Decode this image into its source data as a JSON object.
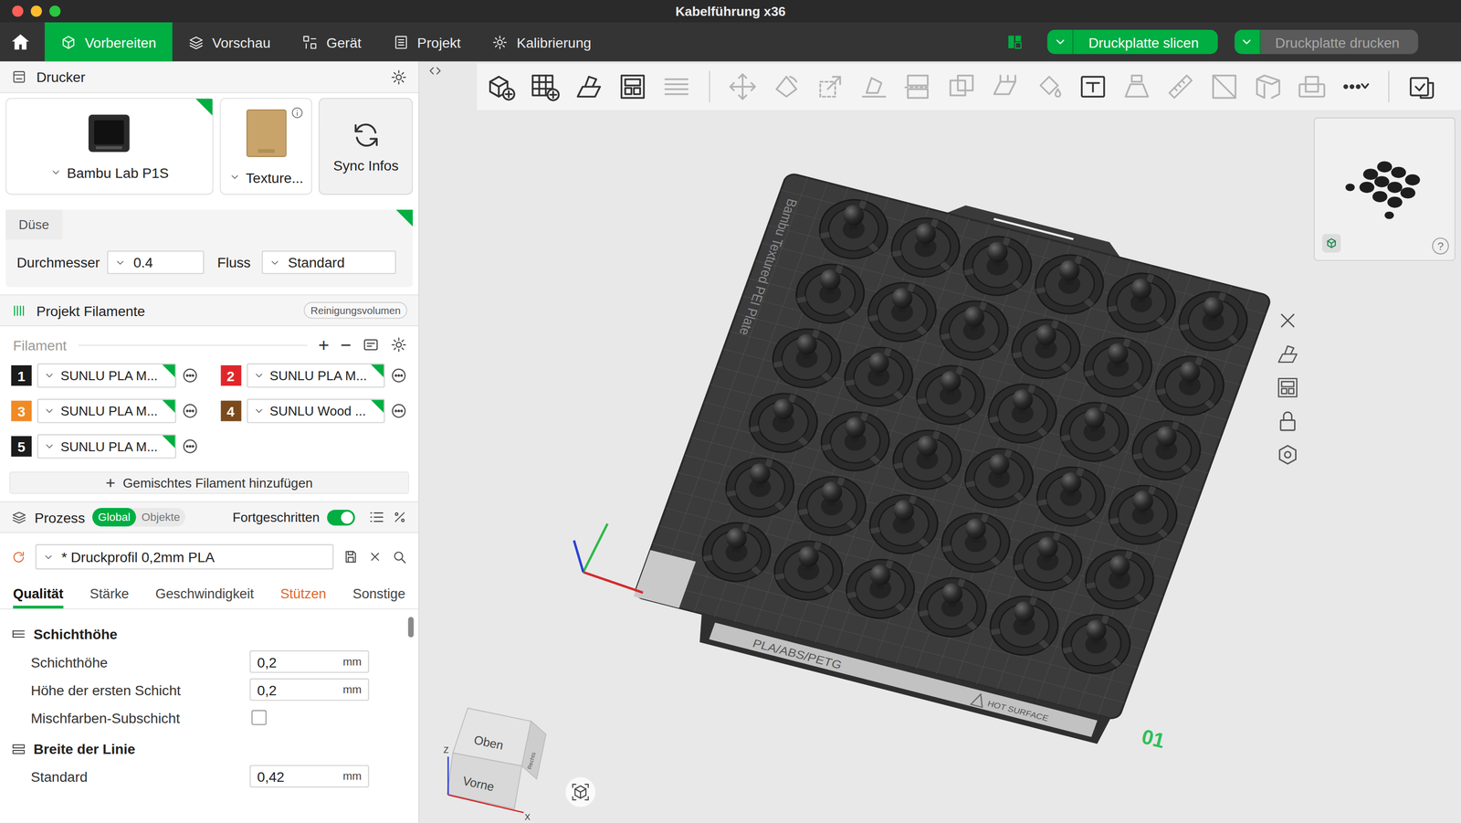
{
  "window": {
    "title": "Kabelführung x36"
  },
  "nav": [
    {
      "label": "Vorbereiten",
      "kind": "prepare",
      "selected": true
    },
    {
      "label": "Vorschau",
      "kind": "preview",
      "selected": false
    },
    {
      "label": "Gerät",
      "kind": "device",
      "selected": false
    },
    {
      "label": "Projekt",
      "kind": "project",
      "selected": false
    },
    {
      "label": "Kalibrierung",
      "kind": "calibrate",
      "selected": false
    }
  ],
  "actions": [
    {
      "label": "Druckplatte slicen",
      "disabled": false
    },
    {
      "label": "Druckplatte drucken",
      "disabled": true
    }
  ],
  "printer": {
    "title": "Drucker",
    "model": "Bambu Lab P1S",
    "model_synced": true,
    "plate": "Texture...",
    "plate_synced": false,
    "sync": "Sync Infos"
  },
  "nozzle": {
    "title": "Düse",
    "synced": true,
    "diameter_label": "Durchmesser",
    "diameter": "0.4",
    "flow_label": "Fluss",
    "flow": "Standard"
  },
  "filaments": {
    "title": "Projekt Filamente",
    "purge": "Reinigungsvolumen",
    "label": "Filament",
    "add": "+",
    "remove": "−",
    "items": [
      {
        "index": "1",
        "name": "SUNLU PLA M...",
        "color": "#1b1b1b",
        "synced": true
      },
      {
        "index": "2",
        "name": "SUNLU PLA M...",
        "color": "#e0262b",
        "synced": true
      },
      {
        "index": "3",
        "name": "SUNLU PLA M...",
        "color": "#f08a24",
        "synced": true
      },
      {
        "index": "4",
        "name": "SUNLU Wood ...",
        "color": "#7a4a1c",
        "synced": true
      },
      {
        "index": "5",
        "name": "SUNLU PLA M...",
        "color": "#1b1b1b",
        "synced": true
      }
    ],
    "add_mixed_icon": "+",
    "add_mixed": "Gemischtes Filament hinzufügen"
  },
  "process": {
    "title": "Prozess",
    "scopes": [
      {
        "label": "Global",
        "selected": true
      },
      {
        "label": "Objekte",
        "selected": false
      }
    ],
    "advanced_label": "Fortgeschritten",
    "advanced": true,
    "profile": "* Druckprofil 0,2mm PLA",
    "tabs": [
      {
        "label": "Qualität",
        "selected": true,
        "modified": false
      },
      {
        "label": "Stärke",
        "selected": false,
        "modified": false
      },
      {
        "label": "Geschwindigkeit",
        "selected": false,
        "modified": false
      },
      {
        "label": "Stützen",
        "selected": false,
        "modified": true
      },
      {
        "label": "Sonstige",
        "selected": false,
        "modified": false
      }
    ],
    "sections": [
      {
        "title": "Schichthöhe",
        "rows": [
          {
            "kind": "number",
            "label": "Schichthöhe",
            "value": "0,2",
            "unit": "mm"
          },
          {
            "kind": "number",
            "label": "Höhe der ersten Schicht",
            "value": "0,2",
            "unit": "mm"
          },
          {
            "kind": "checkbox",
            "label": "Mischfarben-Subschicht",
            "checked": false
          }
        ]
      },
      {
        "title": "Breite der Linie",
        "rows": [
          {
            "kind": "number",
            "label": "Standard",
            "value": "0,42",
            "unit": "mm"
          }
        ]
      }
    ]
  },
  "toolbar": [
    [
      {
        "kind": "add-object",
        "disabled": false
      },
      {
        "kind": "add-plate",
        "disabled": false
      },
      {
        "kind": "auto-orient",
        "disabled": false
      },
      {
        "kind": "arrange",
        "disabled": false
      },
      {
        "kind": "layers",
        "disabled": true
      }
    ],
    [
      {
        "kind": "move",
        "disabled": true
      },
      {
        "kind": "rotate",
        "disabled": true
      },
      {
        "kind": "scale",
        "disabled": true
      },
      {
        "kind": "lay-flat",
        "disabled": true
      },
      {
        "kind": "cut",
        "disabled": true
      },
      {
        "kind": "boolean",
        "disabled": true
      },
      {
        "kind": "support-paint",
        "disabled": true
      },
      {
        "kind": "color-paint",
        "disabled": true
      },
      {
        "kind": "text",
        "disabled": false
      },
      {
        "kind": "emboss",
        "disabled": true
      },
      {
        "kind": "measure",
        "disabled": true
      },
      {
        "kind": "assembly",
        "disabled": true
      },
      {
        "kind": "fuzzy",
        "disabled": true
      },
      {
        "kind": "brim",
        "disabled": true
      },
      {
        "kind": "more",
        "disabled": false
      }
    ],
    [
      {
        "kind": "plate-view",
        "disabled": false
      }
    ]
  ],
  "plate": {
    "name": "Bambu Textured PEI Plate",
    "materials": "PLA/ABS/PETG",
    "warning": "HOT SURFACE",
    "number": "01",
    "objects": 36
  },
  "view_cube": {
    "top": "Oben",
    "front": "Vorne",
    "right": "Rechts",
    "axis_z": "Z",
    "axis_x": "X"
  },
  "navigator": {
    "help": "?"
  }
}
